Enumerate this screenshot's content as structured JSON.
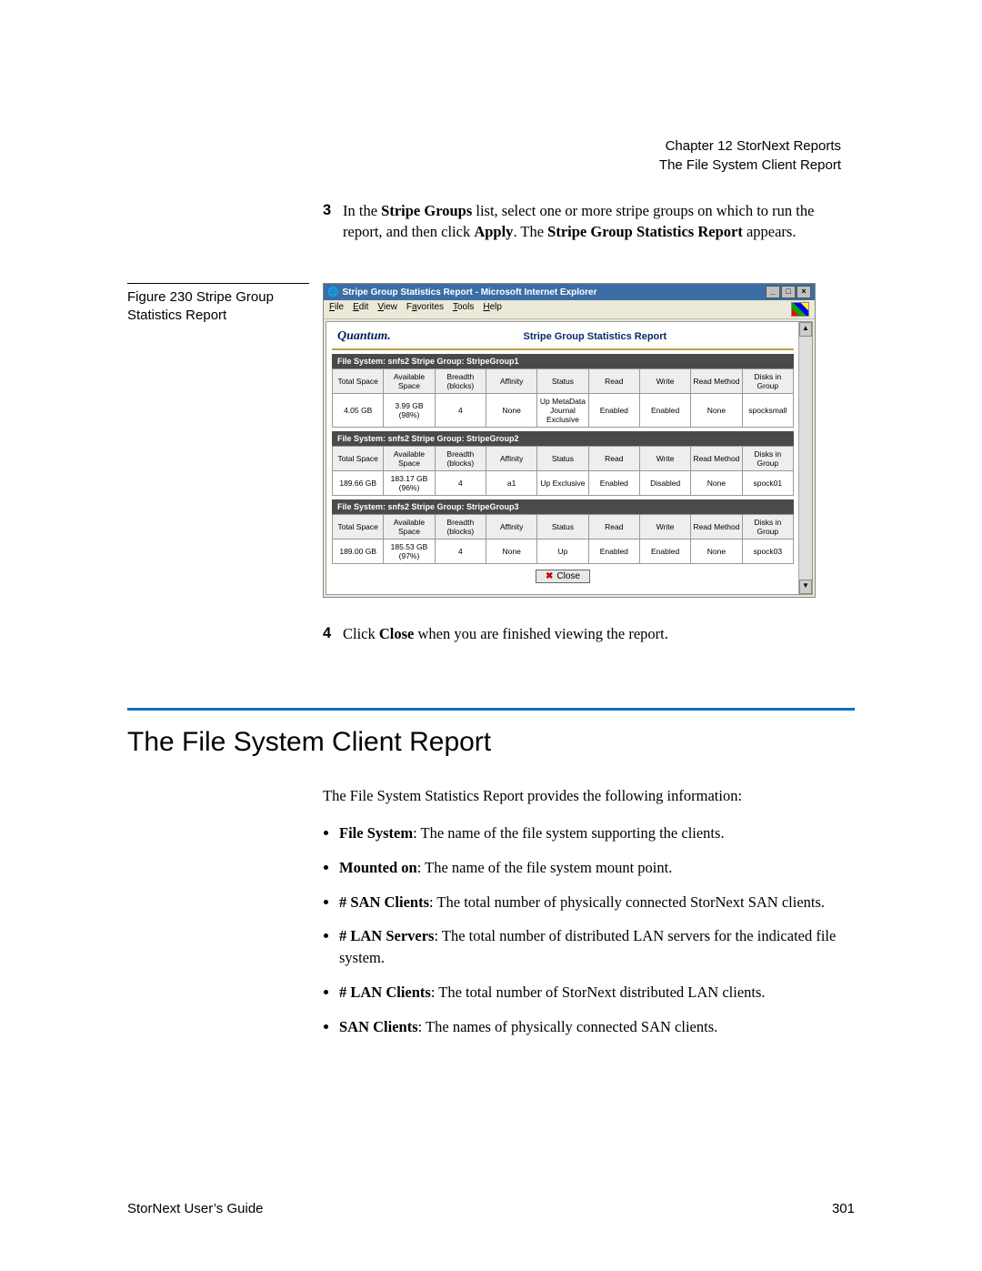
{
  "header": {
    "chapter": "Chapter 12  StorNext Reports",
    "subtitle": "The File System Client Report"
  },
  "step3": {
    "num": "3",
    "text_pre": "In the ",
    "bold1": "Stripe Groups",
    "text_mid1": " list, select one or more stripe groups on which to run the report, and then click ",
    "bold2": "Apply",
    "text_mid2": ". The ",
    "bold3": "Stripe Group Statistics Report",
    "text_end": " appears."
  },
  "figure": {
    "label": "Figure 230  Stripe Group Statistics Report"
  },
  "browser": {
    "title": "Stripe Group Statistics Report - Microsoft Internet Explorer",
    "menus": [
      "File",
      "Edit",
      "View",
      "Favorites",
      "Tools",
      "Help"
    ],
    "brand": "Quantum.",
    "report_title": "Stripe Group Statistics Report",
    "columns": [
      "Total Space",
      "Available Space",
      "Breadth (blocks)",
      "Affinity",
      "Status",
      "Read",
      "Write",
      "Read Method",
      "Disks in Group"
    ],
    "groups": [
      {
        "bar": "File System: snfs2     Stripe Group: StripeGroup1",
        "row": [
          "4.05 GB",
          "3.99 GB (98%)",
          "4",
          "None",
          "Up MetaData Journal Exclusive",
          "Enabled",
          "Enabled",
          "None",
          "spocksmall"
        ]
      },
      {
        "bar": "File System: snfs2     Stripe Group: StripeGroup2",
        "row": [
          "189.66 GB",
          "183.17 GB (96%)",
          "4",
          "a1",
          "Up Exclusive",
          "Enabled",
          "Disabled",
          "None",
          "spock01"
        ]
      },
      {
        "bar": "File System: snfs2     Stripe Group: StripeGroup3",
        "row": [
          "189.00 GB",
          "185.53 GB (97%)",
          "4",
          "None",
          "Up",
          "Enabled",
          "Enabled",
          "None",
          "spock03"
        ]
      }
    ],
    "close_label": "Close"
  },
  "step4": {
    "num": "4",
    "text_pre": "Click ",
    "bold1": "Close",
    "text_end": " when you are finished viewing the report."
  },
  "section": {
    "title": "The File System Client Report",
    "intro": "The File System Statistics Report provides the following information:",
    "items": [
      {
        "term": "File System",
        "desc": ": The name of the file system supporting the clients."
      },
      {
        "term": "Mounted on",
        "desc": ": The name of the file system mount point."
      },
      {
        "term": "# SAN Clients",
        "desc": ": The total number of physically connected StorNext SAN clients."
      },
      {
        "term": "# LAN Servers",
        "desc": ": The total number of distributed LAN servers for the indicated file system."
      },
      {
        "term": "# LAN Clients",
        "desc": ": The total number of StorNext distributed LAN clients."
      },
      {
        "term": "SAN Clients",
        "desc": ": The names of physically connected SAN clients."
      }
    ]
  },
  "footer": {
    "left": "StorNext User’s Guide",
    "right": "301"
  }
}
